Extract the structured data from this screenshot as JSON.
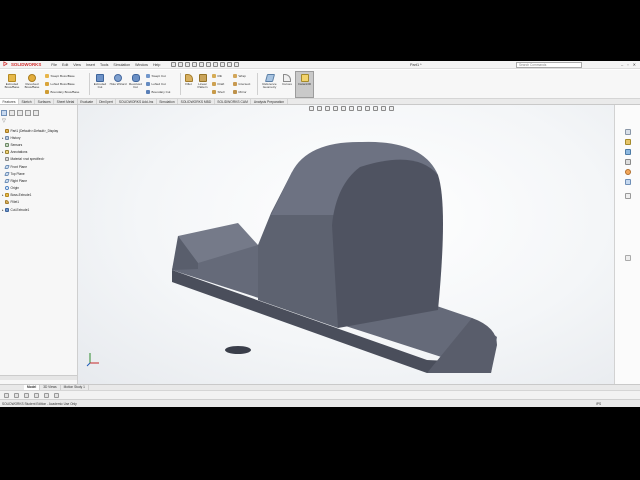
{
  "app": {
    "logo_text": "SOLIDWORKS",
    "doc_title": "Part1 *",
    "search_placeholder": "Search Commands",
    "menu": [
      "File",
      "Edit",
      "View",
      "Insert",
      "Tools",
      "Simulation",
      "Window",
      "Help"
    ]
  },
  "command_manager": {
    "extruded_boss": "Extruded Boss/Base",
    "revolved_boss": "Revolved Boss/Base",
    "swept_boss": "Swept Boss/Base",
    "lofted_boss": "Lofted Boss/Base",
    "boundary_boss": "Boundary Boss/Base",
    "extruded_cut": "Extruded Cut",
    "hole_wizard": "Hole Wizard",
    "revolved_cut": "Revolved Cut",
    "swept_cut": "Swept Cut",
    "lofted_cut": "Lofted Cut",
    "boundary_cut": "Boundary Cut",
    "fillet": "Fillet",
    "linear_pattern": "Linear Pattern",
    "rib": "Rib",
    "draft": "Draft",
    "shell": "Shell",
    "wrap": "Wrap",
    "intersect": "Intersect",
    "mirror": "Mirror",
    "reference_geometry": "Reference Geometry",
    "curves": "Curves",
    "instant3d": "Instant3D"
  },
  "tabs": [
    "Features",
    "Sketch",
    "Surfaces",
    "Sheet Metal",
    "Evaluate",
    "DimXpert",
    "SOLIDWORKS Add-Ins",
    "Simulation",
    "SOLIDWORKS MBD",
    "SOLIDWORKS CAM",
    "Analysis Preparation"
  ],
  "feature_tree": [
    {
      "label": "Part1  (Default<<Default>_Display",
      "expander": ""
    },
    {
      "label": "History",
      "expander": "▸"
    },
    {
      "label": "Sensors",
      "expander": ""
    },
    {
      "label": "Annotations",
      "expander": "▸"
    },
    {
      "label": "Material <not specified>",
      "expander": ""
    },
    {
      "label": "Front Plane",
      "expander": ""
    },
    {
      "label": "Top Plane",
      "expander": ""
    },
    {
      "label": "Right Plane",
      "expander": ""
    },
    {
      "label": "Origin",
      "expander": ""
    },
    {
      "label": "Boss-Extrude1",
      "expander": "▸"
    },
    {
      "label": "Fillet1",
      "expander": ""
    },
    {
      "label": "Cut-Extrude1",
      "expander": "▸"
    }
  ],
  "bottom_tabs": [
    "Model",
    "3D Views",
    "Motion Study 1"
  ],
  "status": {
    "edition": "SOLIDWORKS Student Edition - Academic Use Only",
    "units": "IPS"
  },
  "colors": {
    "brand": "#d32f2f",
    "model_light": "#6f7484",
    "model_dark": "#3b3f4b"
  }
}
